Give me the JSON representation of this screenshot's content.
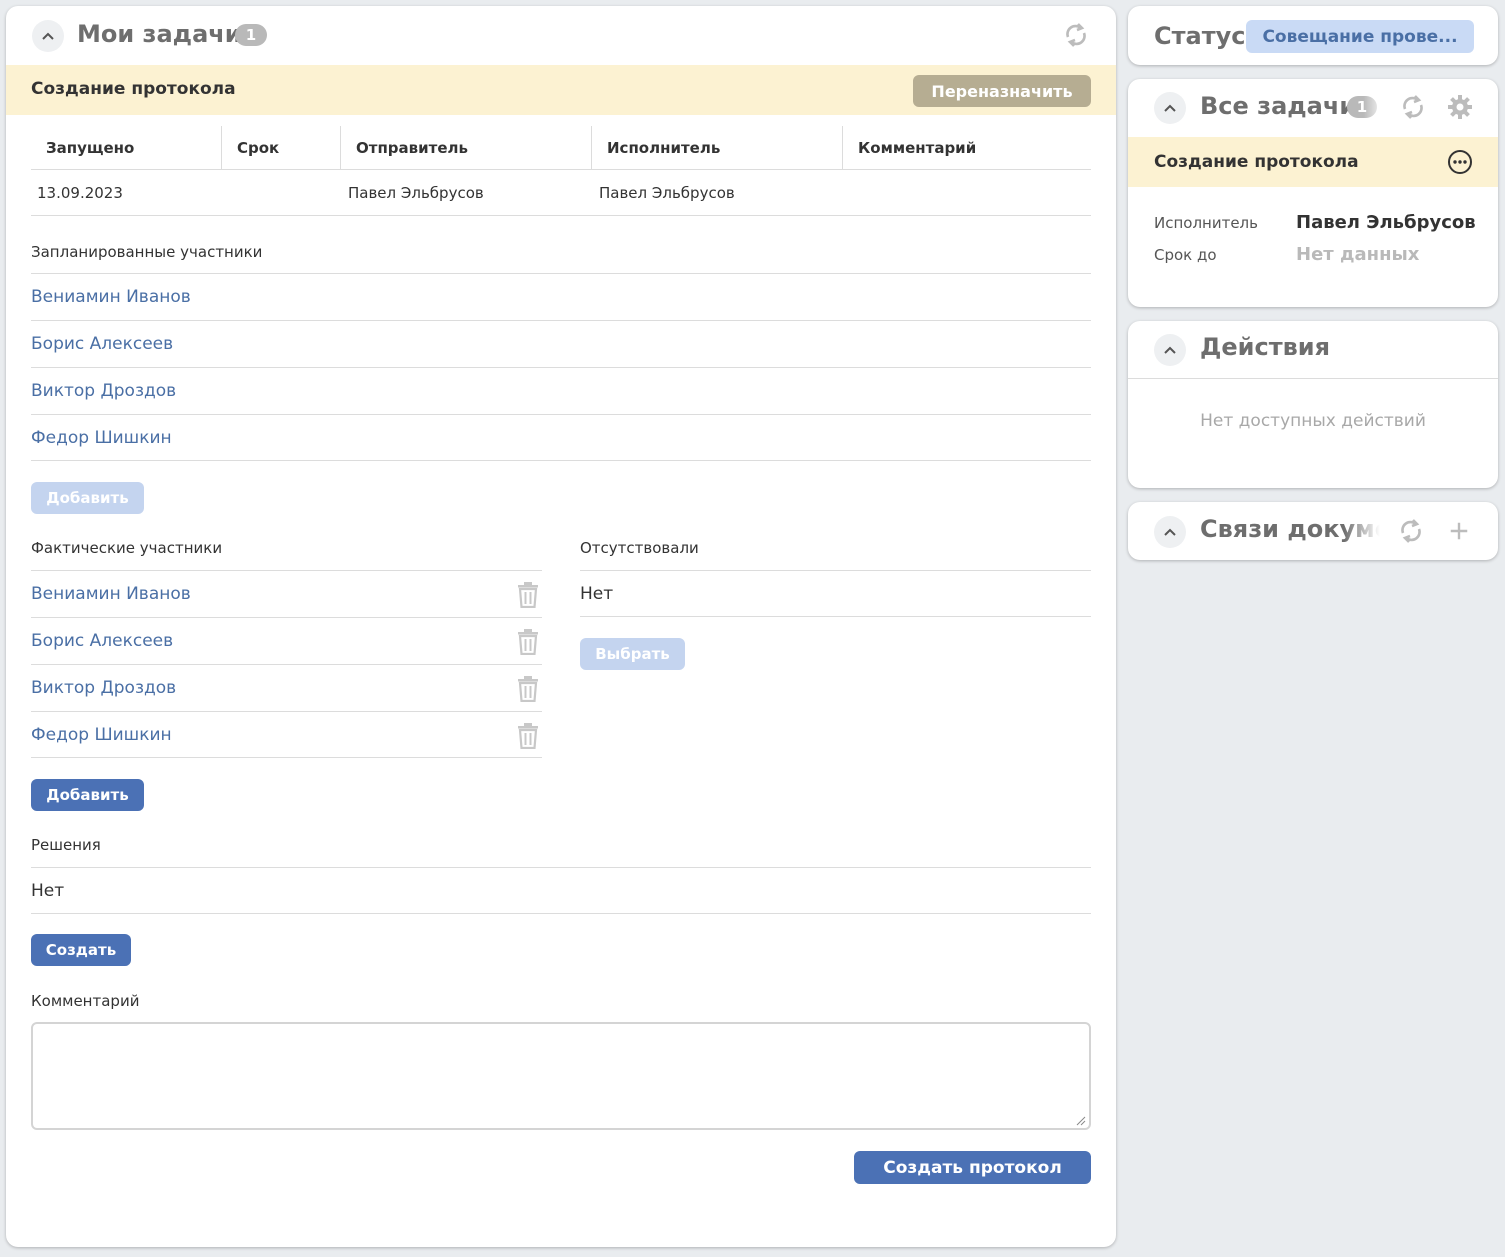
{
  "main": {
    "title": "Мои задачи",
    "count": "1",
    "task_title": "Создание протокола",
    "reassign_label": "Переназначить",
    "table": {
      "headers": [
        "Запущено",
        "Срок",
        "Отправитель",
        "Исполнитель",
        "Комментарий"
      ],
      "row": [
        "13.09.2023",
        "",
        "Павел Эльбрусов",
        "Павел Эльбрусов",
        ""
      ]
    },
    "planned": {
      "label": "Запланированные участники",
      "items": [
        "Вениамин Иванов",
        "Борис Алексеев",
        "Виктор Дроздов",
        "Федор Шишкин"
      ],
      "add_label": "Добавить"
    },
    "actual": {
      "label": "Фактические участники",
      "items": [
        "Вениамин Иванов",
        "Борис Алексеев",
        "Виктор Дроздов",
        "Федор Шишкин"
      ],
      "add_label": "Добавить"
    },
    "absent": {
      "label": "Отсутствовали",
      "value": "Нет",
      "select_label": "Выбрать"
    },
    "decisions": {
      "label": "Решения",
      "value": "Нет",
      "create_label": "Создать"
    },
    "comment": {
      "label": "Комментарий",
      "value": "",
      "placeholder": ""
    },
    "submit_label": "Создать протокол"
  },
  "status": {
    "label": "Статус",
    "value": "Совещание прове..."
  },
  "all_tasks": {
    "title": "Все задачи",
    "count": "1",
    "task_title": "Создание протокола",
    "assignee_label": "Исполнитель",
    "assignee_value": "Павел Эльбрусов",
    "due_label": "Срок до",
    "due_value": "Нет данных"
  },
  "actions": {
    "title": "Действия",
    "empty": "Нет доступных действий"
  },
  "links": {
    "title": "Связи документа"
  },
  "colors": {
    "accent_blue": "#4b71b5",
    "disabled_blue": "#c4d4ef",
    "task_band": "#fcf2d2",
    "reassign_gold": "#b6ad92",
    "link_text": "#4a6fa5"
  },
  "icons": {
    "collapse": "chevron-up-icon",
    "refresh": "refresh-icon",
    "settings": "gear-icon",
    "more": "more-horizontal-icon",
    "add": "plus-icon",
    "delete": "trash-icon"
  }
}
